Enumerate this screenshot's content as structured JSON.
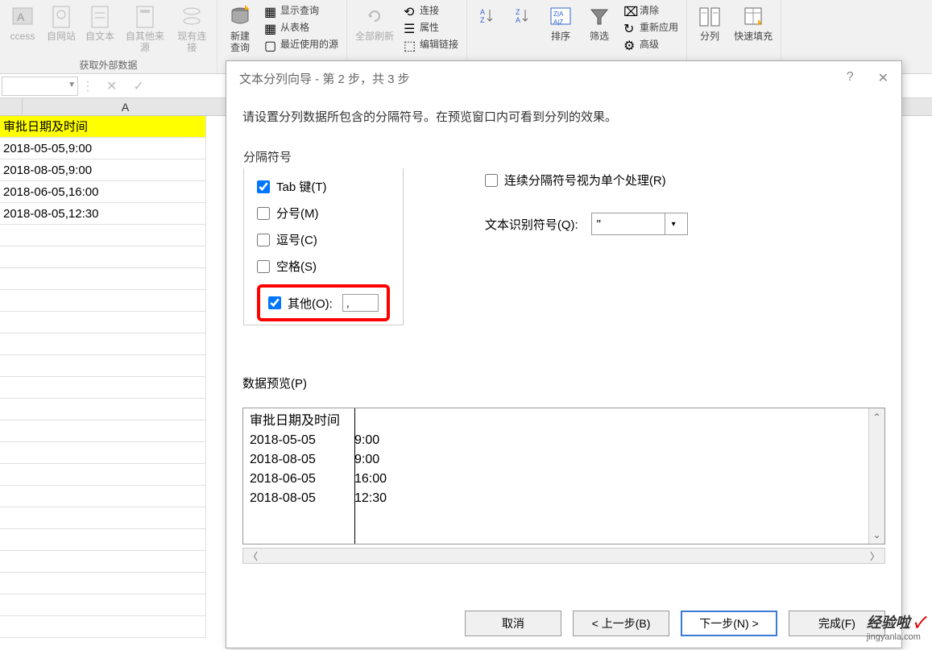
{
  "ribbon": {
    "group1": {
      "access": "ccess",
      "web": "自网站",
      "text": "自文本",
      "other": "自其他来源",
      "existing": "现有连接",
      "label": "获取外部数据"
    },
    "group2": {
      "new_query": "新建\n查询",
      "show_query": "显示查询",
      "from_table": "从表格",
      "recent": "最近使用的源"
    },
    "group3": {
      "refresh_all": "全部刷新",
      "connections": "连接",
      "properties": "属性",
      "edit_links": "编辑链接"
    },
    "group4": {
      "sort": "排序",
      "filter": "筛选",
      "clear": "清除",
      "reapply": "重新应用",
      "advanced": "高级"
    },
    "group5": {
      "text_to_columns": "分列",
      "flash_fill": "快速填充"
    }
  },
  "grid": {
    "col_a": "A",
    "rows": [
      "审批日期及时间",
      "2018-05-05,9:00",
      "2018-08-05,9:00",
      "2018-06-05,16:00",
      "2018-08-05,12:30"
    ]
  },
  "dialog": {
    "title": "文本分列向导 - 第 2 步，共 3 步",
    "description": "请设置分列数据所包含的分隔符号。在预览窗口内可看到分列的效果。",
    "delimiters_label": "分隔符号",
    "tab_label": "Tab 键(T)",
    "semicolon_label": "分号(M)",
    "comma_label": "逗号(C)",
    "space_label": "空格(S)",
    "other_label": "其他(O):",
    "other_value": ",",
    "consecutive_label": "连续分隔符号视为单个处理(R)",
    "qualifier_label": "文本识别符号(Q):",
    "qualifier_value": "\"",
    "preview_label": "数据预览(P)",
    "preview_rows": [
      {
        "c1": "审批日期及时间",
        "c2": ""
      },
      {
        "c1": "2018-05-05",
        "c2": "9:00"
      },
      {
        "c1": "2018-08-05",
        "c2": "9:00"
      },
      {
        "c1": "2018-06-05",
        "c2": "16:00"
      },
      {
        "c1": "2018-08-05",
        "c2": "12:30"
      }
    ],
    "buttons": {
      "cancel": "取消",
      "back": "< 上一步(B)",
      "next": "下一步(N) >",
      "finish": "完成(F)"
    }
  },
  "watermark": {
    "main": "经验啦",
    "sub": "jingyanla.com"
  }
}
